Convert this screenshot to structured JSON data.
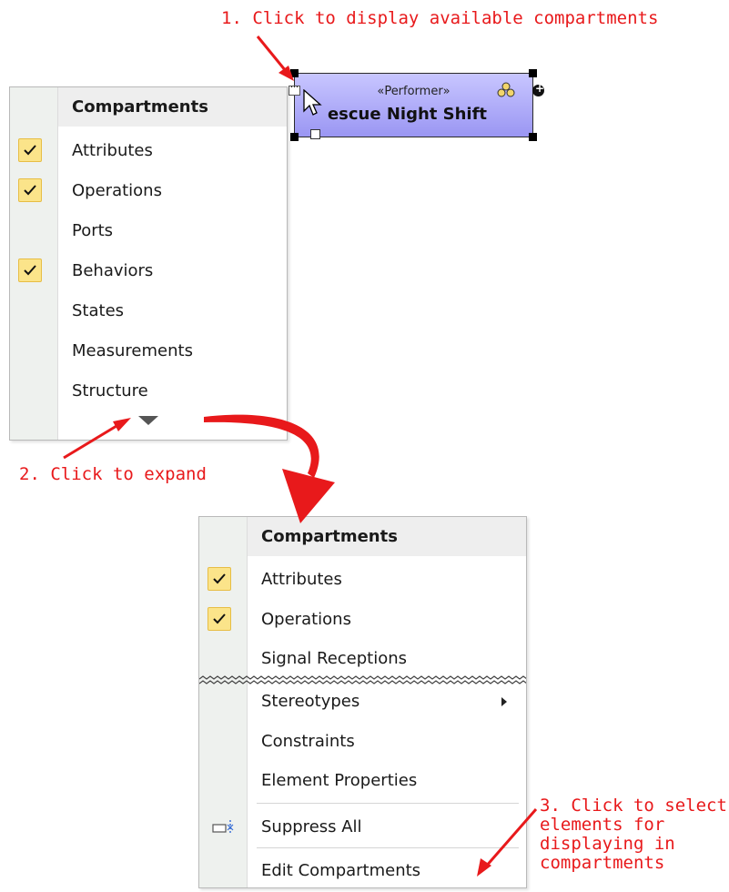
{
  "annotations": {
    "step1": "1. Click to display available compartments",
    "step2": "2. Click to expand",
    "step3_lines": [
      "3. Click to select",
      "elements for",
      "displaying in",
      "compartments"
    ]
  },
  "element": {
    "stereotype": "«Performer»",
    "name": "escue Night Shift",
    "fill_color": "#a9a6f7"
  },
  "menu_collapsed": {
    "header": "Compartments",
    "items": [
      {
        "label": "Attributes",
        "checked": true
      },
      {
        "label": "Operations",
        "checked": true
      },
      {
        "label": "Ports",
        "checked": false
      },
      {
        "label": "Behaviors",
        "checked": true
      },
      {
        "label": "States",
        "checked": false
      },
      {
        "label": "Measurements",
        "checked": false
      },
      {
        "label": "Structure",
        "checked": false
      }
    ]
  },
  "menu_expanded": {
    "header": "Compartments",
    "items": [
      {
        "label": "Attributes",
        "checked": true
      },
      {
        "label": "Operations",
        "checked": true
      },
      {
        "label": "Signal Receptions",
        "checked": false
      },
      {
        "label": "Stereotypes",
        "checked": false,
        "submenu": true
      },
      {
        "label": "Constraints",
        "checked": false
      },
      {
        "label": "Element Properties",
        "checked": false
      },
      {
        "label": "Suppress All",
        "checked": false,
        "icon": "suppress-all-icon"
      },
      {
        "label": "Edit Compartments",
        "checked": false
      }
    ]
  },
  "colors": {
    "annotation": "#e8191b",
    "check_bg": "#fbe48a",
    "menu_gutter": "#eef1ee"
  }
}
